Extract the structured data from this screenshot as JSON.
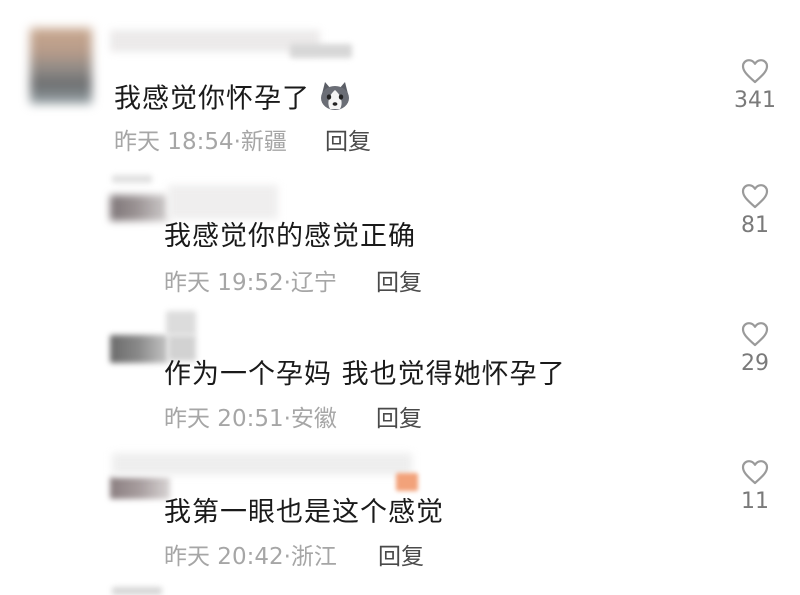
{
  "comments": [
    {
      "text": "我感觉你怀孕了",
      "emoji": "husky-dog-emoji",
      "time": "昨天 18:54",
      "location": "新疆",
      "reply": "回复",
      "likes": "341"
    },
    {
      "text": "我感觉你的感觉正确",
      "time": "昨天 19:52",
      "location": "辽宁",
      "reply": "回复",
      "likes": "81"
    },
    {
      "text": "作为一个孕妈 我也觉得她怀孕了",
      "time": "昨天 20:51",
      "location": "安徽",
      "reply": "回复",
      "likes": "29"
    },
    {
      "text": "我第一眼也是这个感觉",
      "time": "昨天 20:42",
      "location": "浙江",
      "reply": "回复",
      "likes": "11"
    }
  ],
  "meta_separator": "·",
  "icons": {
    "like": "heart-outline-icon"
  },
  "colors": {
    "text": "#1a1a1a",
    "meta": "#a6a6a6",
    "reply": "#4a4a4a",
    "like": "#9a9a9a",
    "orange_badge": "#f2a27a"
  }
}
